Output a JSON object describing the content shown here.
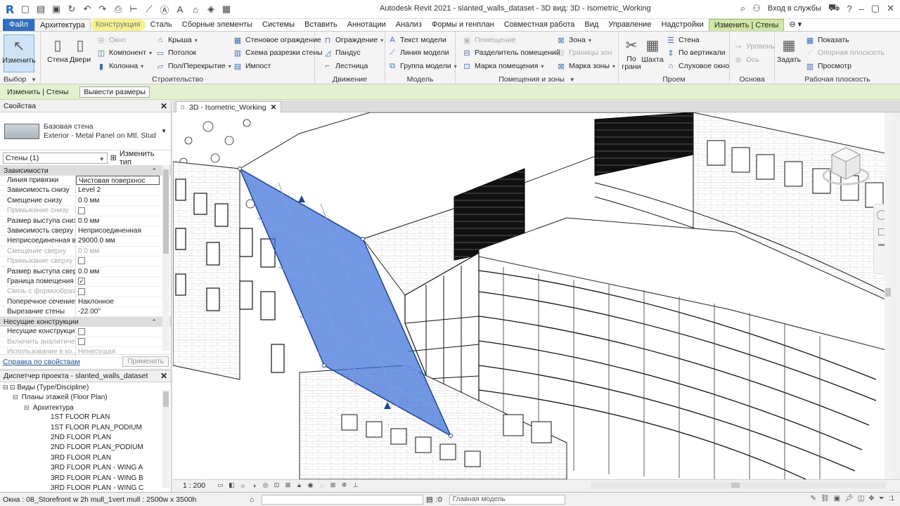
{
  "window": {
    "title": "Autodesk Revit 2021 - slanted_walls_dataset - 3D вид: 3D - Isometric_Working",
    "login_label": "Вход в службы"
  },
  "tabs": [
    {
      "label": "Файл"
    },
    {
      "label": "Архитектура"
    },
    {
      "label": "Конструкция"
    },
    {
      "label": "Сталь"
    },
    {
      "label": "Сборные элементы"
    },
    {
      "label": "Системы"
    },
    {
      "label": "Вставить"
    },
    {
      "label": "Аннотации"
    },
    {
      "label": "Анализ"
    },
    {
      "label": "Формы и генплан"
    },
    {
      "label": "Совместная работа"
    },
    {
      "label": "Вид"
    },
    {
      "label": "Управление"
    },
    {
      "label": "Надстройки"
    },
    {
      "label": "Изменить | Стены"
    }
  ],
  "ribbon": {
    "select": {
      "modify": "Изменить",
      "panel": "Выбор"
    },
    "build": {
      "wall": "Стена",
      "door": "Двери",
      "window": "Окно",
      "component": "Компонент",
      "column": "Колонна",
      "roof": "Крыша",
      "ceiling": "Потолок",
      "floor": "Пол/Перекрытие",
      "curtain_system": "Стеновое ограждение",
      "curtain_grid": "Схема разрезки стены",
      "mullion": "Импост",
      "panel": "Строительство"
    },
    "circulation": {
      "railing": "Ограждение",
      "ramp": "Пандус",
      "stair": "Лестница",
      "panel": "Движение"
    },
    "model": {
      "text": "Текст модели",
      "line": "Линия модели",
      "group": "Группа модели",
      "panel": "Модель"
    },
    "room": {
      "room": "Помещение",
      "separator": "Разделитель помещений",
      "tag_room": "Марка помещения",
      "area": "Зона",
      "area_boundary": "Границы зон",
      "tag_area": "Марка зоны",
      "panel": "Помещения и зоны"
    },
    "opening": {
      "by_face": "По грани",
      "shaft": "Шахта",
      "wall": "Стена",
      "vertical": "По вертикали",
      "dormer": "Слуховое окно",
      "panel": "Проем"
    },
    "datum": {
      "level": "Уровень",
      "grid": "Ось",
      "panel": "Основа"
    },
    "workplane": {
      "set": "Задать",
      "show": "Показать",
      "ref_plane": "Опорная плоскость",
      "viewer": "Просмотр",
      "panel": "Рабочая плоскость"
    }
  },
  "optbar": {
    "context": "Изменить | Стены",
    "button": "Вывести размеры"
  },
  "properties": {
    "title": "Свойства",
    "type_line1": "Базовая стена",
    "type_line2": "Exterior - Metal Panel on Mtl. Stud",
    "instance": "Стены (1)",
    "edit_type": "Изменить тип",
    "groups": [
      {
        "name": "Зависимости",
        "rows": [
          {
            "key": "Линия привязки",
            "value": "Чистовая поверхнос"
          },
          {
            "key": "Зависимость снизу",
            "value": "Level 2"
          },
          {
            "key": "Смещение снизу",
            "value": "0.0 мм"
          },
          {
            "key": "Примыкание снизу",
            "value": ""
          },
          {
            "key": "Размер выступа снизу",
            "value": "0.0 мм"
          },
          {
            "key": "Зависимость сверху",
            "value": "Неприсоединенная"
          },
          {
            "key": "Неприсоединенная в...",
            "value": "29000.0 мм"
          },
          {
            "key": "Смещение сверху",
            "value": "0.0 мм"
          },
          {
            "key": "Примыкание сверху",
            "value": ""
          },
          {
            "key": "Размер выступа свер...",
            "value": "0.0 мм"
          },
          {
            "key": "Граница помещения",
            "value": "✓"
          },
          {
            "key": "Связь с формообраз...",
            "value": ""
          },
          {
            "key": "Поперечное сечение",
            "value": "Наклонное"
          },
          {
            "key": "Вырезание стены",
            "value": "-22.00°"
          }
        ]
      },
      {
        "name": "Несущие конструкции",
        "rows": [
          {
            "key": "Несущие конструкции",
            "value": ""
          },
          {
            "key": "Включить аналитиче...",
            "value": ""
          },
          {
            "key": "Использование в ко...",
            "value": "Ненесущая"
          }
        ]
      }
    ],
    "help_link": "Справка по свойствам",
    "apply": "Применить"
  },
  "browser": {
    "title": "Диспетчер проекта - slanted_walls_dataset",
    "root": "Виды (Type/Discipline)",
    "floor_plans": "Планы этажей (Floor Plan)",
    "discipline": "Архитектура",
    "items": [
      "1ST FLOOR PLAN",
      "1ST FLOOR PLAN_PODIUM",
      "2ND FLOOR PLAN",
      "2ND FLOOR PLAN_PODIUM",
      "3RD FLOOR PLAN",
      "3RD FLOOR PLAN - WING A",
      "3RD FLOOR PLAN - WING B",
      "3RD FLOOR PLAN - WING C"
    ]
  },
  "view": {
    "tab": "3D - Isometric_Working",
    "scale": "1 : 200"
  },
  "status": {
    "message": "Окна : 08_Storefront w 2h mull_1vert mull : 2500w x 3500h",
    "zero": ":0",
    "model": "Главная модель",
    "filter": ":1"
  },
  "colors": {
    "accent": "#2f6fbd",
    "context_tab": "#cfe8a3",
    "selection": "#3b6fd8"
  }
}
